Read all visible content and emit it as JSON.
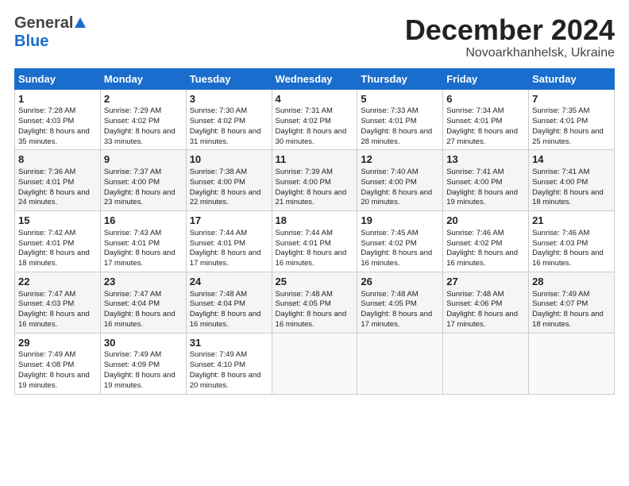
{
  "header": {
    "logo_line1": "General",
    "logo_line2": "Blue",
    "title": "December 2024",
    "subtitle": "Novoarkhanhelsk, Ukraine"
  },
  "days_header": [
    "Sunday",
    "Monday",
    "Tuesday",
    "Wednesday",
    "Thursday",
    "Friday",
    "Saturday"
  ],
  "weeks": [
    [
      {
        "day": "1",
        "sunrise": "7:28 AM",
        "sunset": "4:03 PM",
        "daylight": "8 hours and 35 minutes."
      },
      {
        "day": "2",
        "sunrise": "7:29 AM",
        "sunset": "4:02 PM",
        "daylight": "8 hours and 33 minutes."
      },
      {
        "day": "3",
        "sunrise": "7:30 AM",
        "sunset": "4:02 PM",
        "daylight": "8 hours and 31 minutes."
      },
      {
        "day": "4",
        "sunrise": "7:31 AM",
        "sunset": "4:02 PM",
        "daylight": "8 hours and 30 minutes."
      },
      {
        "day": "5",
        "sunrise": "7:33 AM",
        "sunset": "4:01 PM",
        "daylight": "8 hours and 28 minutes."
      },
      {
        "day": "6",
        "sunrise": "7:34 AM",
        "sunset": "4:01 PM",
        "daylight": "8 hours and 27 minutes."
      },
      {
        "day": "7",
        "sunrise": "7:35 AM",
        "sunset": "4:01 PM",
        "daylight": "8 hours and 25 minutes."
      }
    ],
    [
      {
        "day": "8",
        "sunrise": "7:36 AM",
        "sunset": "4:01 PM",
        "daylight": "8 hours and 24 minutes."
      },
      {
        "day": "9",
        "sunrise": "7:37 AM",
        "sunset": "4:00 PM",
        "daylight": "8 hours and 23 minutes."
      },
      {
        "day": "10",
        "sunrise": "7:38 AM",
        "sunset": "4:00 PM",
        "daylight": "8 hours and 22 minutes."
      },
      {
        "day": "11",
        "sunrise": "7:39 AM",
        "sunset": "4:00 PM",
        "daylight": "8 hours and 21 minutes."
      },
      {
        "day": "12",
        "sunrise": "7:40 AM",
        "sunset": "4:00 PM",
        "daylight": "8 hours and 20 minutes."
      },
      {
        "day": "13",
        "sunrise": "7:41 AM",
        "sunset": "4:00 PM",
        "daylight": "8 hours and 19 minutes."
      },
      {
        "day": "14",
        "sunrise": "7:41 AM",
        "sunset": "4:00 PM",
        "daylight": "8 hours and 18 minutes."
      }
    ],
    [
      {
        "day": "15",
        "sunrise": "7:42 AM",
        "sunset": "4:01 PM",
        "daylight": "8 hours and 18 minutes."
      },
      {
        "day": "16",
        "sunrise": "7:43 AM",
        "sunset": "4:01 PM",
        "daylight": "8 hours and 17 minutes."
      },
      {
        "day": "17",
        "sunrise": "7:44 AM",
        "sunset": "4:01 PM",
        "daylight": "8 hours and 17 minutes."
      },
      {
        "day": "18",
        "sunrise": "7:44 AM",
        "sunset": "4:01 PM",
        "daylight": "8 hours and 16 minutes."
      },
      {
        "day": "19",
        "sunrise": "7:45 AM",
        "sunset": "4:02 PM",
        "daylight": "8 hours and 16 minutes."
      },
      {
        "day": "20",
        "sunrise": "7:46 AM",
        "sunset": "4:02 PM",
        "daylight": "8 hours and 16 minutes."
      },
      {
        "day": "21",
        "sunrise": "7:46 AM",
        "sunset": "4:03 PM",
        "daylight": "8 hours and 16 minutes."
      }
    ],
    [
      {
        "day": "22",
        "sunrise": "7:47 AM",
        "sunset": "4:03 PM",
        "daylight": "8 hours and 16 minutes."
      },
      {
        "day": "23",
        "sunrise": "7:47 AM",
        "sunset": "4:04 PM",
        "daylight": "8 hours and 16 minutes."
      },
      {
        "day": "24",
        "sunrise": "7:48 AM",
        "sunset": "4:04 PM",
        "daylight": "8 hours and 16 minutes."
      },
      {
        "day": "25",
        "sunrise": "7:48 AM",
        "sunset": "4:05 PM",
        "daylight": "8 hours and 16 minutes."
      },
      {
        "day": "26",
        "sunrise": "7:48 AM",
        "sunset": "4:05 PM",
        "daylight": "8 hours and 17 minutes."
      },
      {
        "day": "27",
        "sunrise": "7:48 AM",
        "sunset": "4:06 PM",
        "daylight": "8 hours and 17 minutes."
      },
      {
        "day": "28",
        "sunrise": "7:49 AM",
        "sunset": "4:07 PM",
        "daylight": "8 hours and 18 minutes."
      }
    ],
    [
      {
        "day": "29",
        "sunrise": "7:49 AM",
        "sunset": "4:08 PM",
        "daylight": "8 hours and 19 minutes."
      },
      {
        "day": "30",
        "sunrise": "7:49 AM",
        "sunset": "4:09 PM",
        "daylight": "8 hours and 19 minutes."
      },
      {
        "day": "31",
        "sunrise": "7:49 AM",
        "sunset": "4:10 PM",
        "daylight": "8 hours and 20 minutes."
      },
      null,
      null,
      null,
      null
    ]
  ]
}
